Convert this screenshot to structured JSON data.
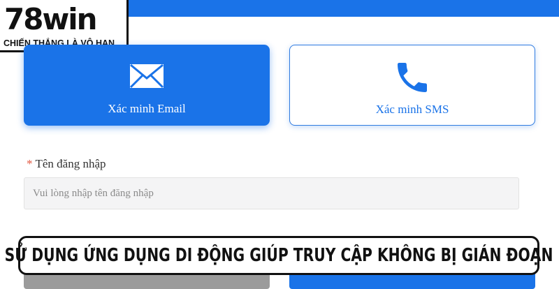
{
  "logo": {
    "wordmark": "78win",
    "tagline": "CHIẾN THẮNG LÀ VÔ HẠN"
  },
  "verification": {
    "email": {
      "label": "Xác minh Email",
      "icon": "envelope-icon",
      "selected": true
    },
    "sms": {
      "label": "Xác minh SMS",
      "icon": "phone-icon",
      "selected": false
    }
  },
  "username": {
    "required_mark": "*",
    "label": "Tên đăng nhập",
    "placeholder": "Vui lòng nhập tên đăng nhập",
    "value": ""
  },
  "banner": {
    "text": "SỬ DỤNG ỨNG DỤNG DI ĐỘNG GIÚP TRUY CẬP KHÔNG BỊ GIÁN ĐOẠN"
  },
  "colors": {
    "primary": "#1a73e8",
    "secondary_button": "#9b9b9b",
    "required": "#e2553e"
  }
}
